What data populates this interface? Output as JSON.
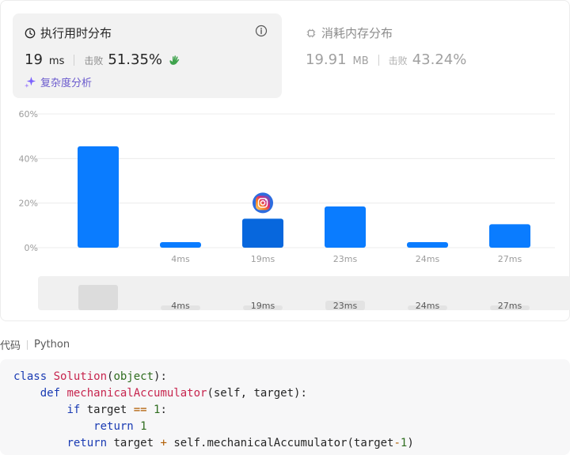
{
  "runtime": {
    "title": "执行用时分布",
    "value": "19",
    "unit": "ms",
    "beat_label": "击败",
    "beat_value": "51.35%",
    "analyze_label": "复杂度分析"
  },
  "memory": {
    "title": "消耗内存分布",
    "value": "19.91",
    "unit": "MB",
    "beat_label": "击败",
    "beat_value": "43.24%"
  },
  "chart_data": {
    "type": "bar",
    "y_ticks": [
      "60%",
      "40%",
      "20%",
      "0%"
    ],
    "ylim": [
      0,
      60
    ],
    "categories": [
      "",
      "4ms",
      "19ms",
      "23ms",
      "24ms",
      "27ms"
    ],
    "values": [
      45.5,
      2.5,
      13,
      18.5,
      2.5,
      10.5
    ],
    "highlight_index": 2,
    "colors": {
      "bar": "#0a7cff",
      "bar_highlight": "#0767dd",
      "grid": "#ececec",
      "tick": "#9c9c9c"
    }
  },
  "overview": {
    "labels": [
      "",
      "4ms",
      "19ms",
      "23ms",
      "24ms",
      "27ms"
    ]
  },
  "code": {
    "label": "代码",
    "language": "Python",
    "lines": [
      [
        [
          "kw",
          "class "
        ],
        [
          "cls",
          "Solution"
        ],
        [
          "pl",
          "("
        ],
        [
          "bi",
          "object"
        ],
        [
          "pl",
          "):"
        ]
      ],
      [
        [
          "pl",
          "    "
        ],
        [
          "kw",
          "def "
        ],
        [
          "fn",
          "mechanicalAccumulator"
        ],
        [
          "pl",
          "(self, target):"
        ]
      ],
      [
        [
          "pl",
          "        "
        ],
        [
          "kw",
          "if "
        ],
        [
          "pl",
          "target "
        ],
        [
          "op",
          "=="
        ],
        [
          "pl",
          " "
        ],
        [
          "num",
          "1"
        ],
        [
          "pl",
          ":"
        ]
      ],
      [
        [
          "pl",
          "            "
        ],
        [
          "kw",
          "return "
        ],
        [
          "num",
          "1"
        ]
      ],
      [
        [
          "pl",
          "        "
        ],
        [
          "kw",
          "return "
        ],
        [
          "pl",
          "target "
        ],
        [
          "op",
          "+"
        ],
        [
          "pl",
          " self.mechanicalAccumulator(target"
        ],
        [
          "op",
          "-"
        ],
        [
          "num",
          "1"
        ],
        [
          "pl",
          ")"
        ]
      ]
    ]
  }
}
